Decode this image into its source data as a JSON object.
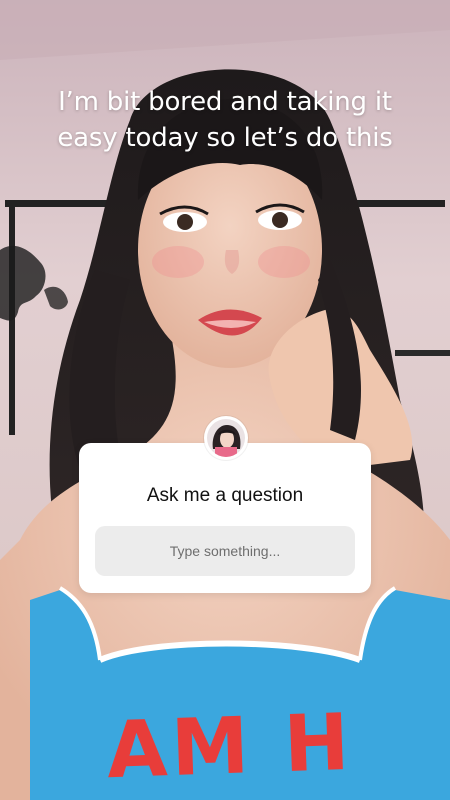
{
  "story": {
    "caption_line1": "I’m bit bored and taking it",
    "caption_line2": "easy today so let’s do this"
  },
  "question_sticker": {
    "title": "Ask me a question",
    "input_placeholder": "Type something..."
  },
  "background": {
    "top_print": "AM H",
    "wall_color": "#d9c6c6",
    "top_color": "#3ba7de"
  }
}
